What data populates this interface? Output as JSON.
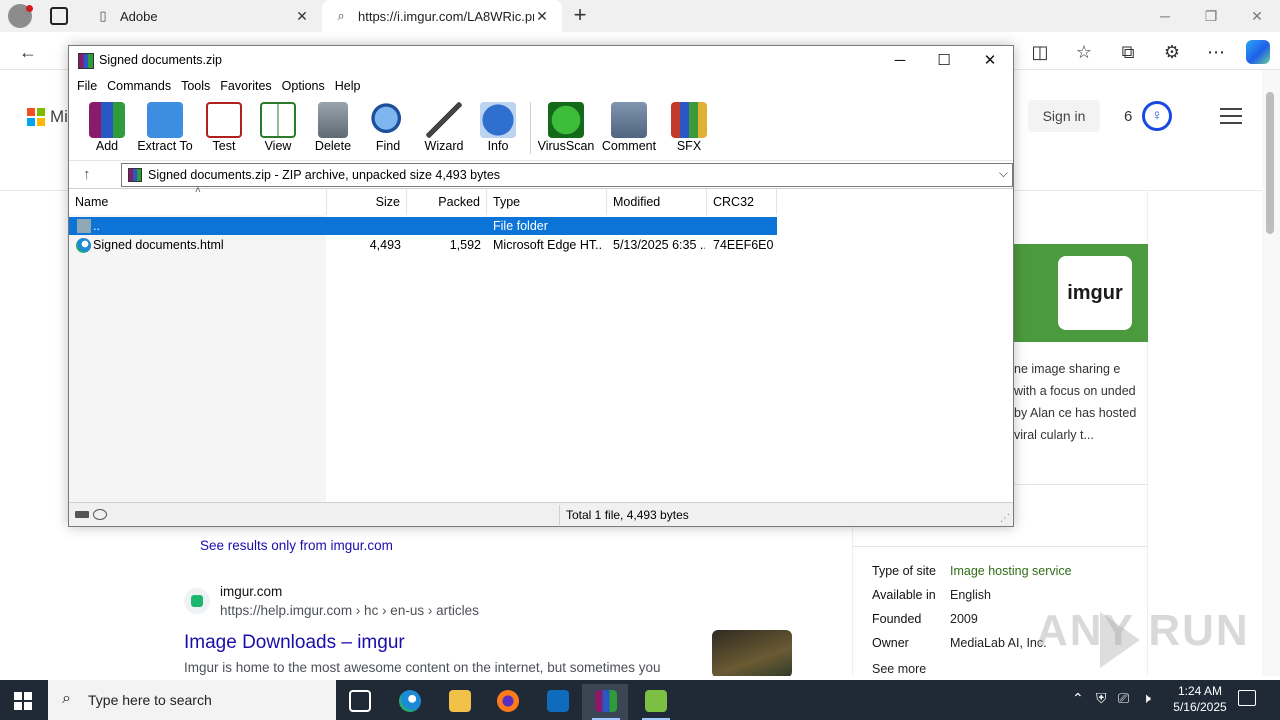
{
  "browser": {
    "tabs": [
      {
        "label": "Adobe",
        "icon": "document-icon"
      },
      {
        "label": "https://i.imgur.com/LA8WRic.pn",
        "icon": "search-icon"
      }
    ],
    "window_controls": {
      "minimize": "─",
      "restore": "❐",
      "close": "✕"
    }
  },
  "bing": {
    "brand": "Mi",
    "signin": "Sign in",
    "rewards_count": "6",
    "see_results": "See results only from imgur.com",
    "result": {
      "site": "imgur.com",
      "url": "https://help.imgur.com › hc › en-us › articles",
      "title": "Image Downloads – imgur",
      "snippet": "Imgur is home to the most awesome content on the internet, but sometimes you"
    },
    "knowledge": {
      "logo_text": "imgur",
      "description": "ne image sharing e with a focus on unded by Alan ce has hosted viral cularly t...",
      "facts": [
        {
          "label": "Type of site",
          "value": "Image hosting service"
        },
        {
          "label": "Available in",
          "value": "English"
        },
        {
          "label": "Founded",
          "value": "2009"
        },
        {
          "label": "Owner",
          "value": "MediaLab AI, Inc."
        }
      ],
      "see_more": "See more"
    },
    "watermark": "ANY RUN"
  },
  "winrar": {
    "title": "Signed documents.zip",
    "controls": {
      "minimize": "─",
      "maximize": "☐",
      "close": "✕"
    },
    "menu": [
      "File",
      "Commands",
      "Tools",
      "Favorites",
      "Options",
      "Help"
    ],
    "toolbar": [
      {
        "label": "Add",
        "icon": "add-archive-icon"
      },
      {
        "label": "Extract To",
        "icon": "extract-folder-icon"
      },
      {
        "label": "Test",
        "icon": "test-clipboard-icon"
      },
      {
        "label": "View",
        "icon": "view-book-icon"
      },
      {
        "label": "Delete",
        "icon": "delete-trash-icon"
      },
      {
        "label": "Find",
        "icon": "find-magnifier-icon"
      },
      {
        "label": "Wizard",
        "icon": "wizard-wand-icon"
      },
      {
        "label": "Info",
        "icon": "info-icon"
      },
      {
        "label": "VirusScan",
        "icon": "virus-scan-icon"
      },
      {
        "label": "Comment",
        "icon": "comment-icon"
      },
      {
        "label": "SFX",
        "icon": "sfx-icon"
      }
    ],
    "path": "Signed documents.zip - ZIP archive, unpacked size 4,493 bytes",
    "columns": {
      "name": "Name",
      "size": "Size",
      "packed": "Packed",
      "type": "Type",
      "modified": "Modified",
      "crc": "CRC32"
    },
    "rows": [
      {
        "name": "..",
        "size": "",
        "packed": "",
        "type": "File folder",
        "modified": "",
        "crc": "",
        "icon": "folder-icon",
        "selected": true
      },
      {
        "name": "Signed documents.html",
        "size": "4,493",
        "packed": "1,592",
        "type": "Microsoft Edge HT...",
        "modified": "5/13/2025 6:35 ...",
        "crc": "74EEF6E0",
        "icon": "edge-html-icon",
        "selected": false
      }
    ],
    "status": "Total 1 file, 4,493 bytes"
  },
  "taskbar": {
    "search_placeholder": "Type here to search",
    "time": "1:24 AM",
    "date": "5/16/2025"
  },
  "colors": {
    "selection": "#0c74d6",
    "link": "#1a0dab",
    "taskbar": "#1f2a36",
    "kp_green": "#4c9a3e"
  }
}
